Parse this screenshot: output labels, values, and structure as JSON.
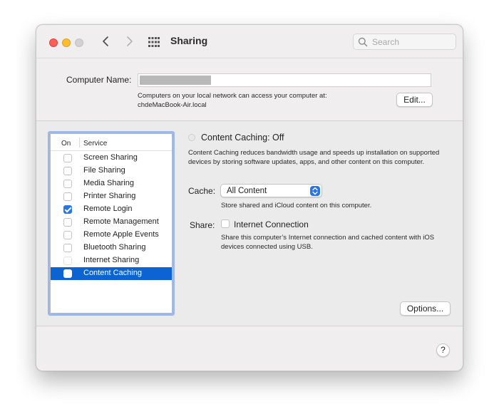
{
  "window": {
    "title": "Sharing",
    "search_placeholder": "Search"
  },
  "computer_name": {
    "label": "Computer Name:",
    "desc_line1": "Computers on your local network can access your computer at:",
    "desc_line2": "chdeMacBook-Air.local",
    "edit_button": "Edit..."
  },
  "service_list": {
    "header_on": "On",
    "header_service": "Service",
    "items": [
      {
        "label": "Screen Sharing",
        "checked": false
      },
      {
        "label": "File Sharing",
        "checked": false
      },
      {
        "label": "Media Sharing",
        "checked": false
      },
      {
        "label": "Printer Sharing",
        "checked": false
      },
      {
        "label": "Remote Login",
        "checked": true
      },
      {
        "label": "Remote Management",
        "checked": false
      },
      {
        "label": "Remote Apple Events",
        "checked": false
      },
      {
        "label": "Bluetooth Sharing",
        "checked": false
      },
      {
        "label": "Internet Sharing",
        "checked": false
      },
      {
        "label": "Content Caching",
        "checked": false,
        "selected": true
      }
    ]
  },
  "detail": {
    "status": "Content Caching: Off",
    "description": "Content Caching reduces bandwidth usage and speeds up installation on supported devices by storing software updates, apps, and other content on this computer.",
    "cache_label": "Cache:",
    "cache_value": "All Content",
    "cache_note": "Store shared and iCloud content on this computer.",
    "share_label": "Share:",
    "share_option": "Internet Connection",
    "share_checked": false,
    "share_note": "Share this computer’s Internet connection and cached content with iOS devices connected using USB.",
    "options_button": "Options..."
  },
  "help_button": "?",
  "colors": {
    "accent": "#0c64d3",
    "checkbox_blue": "#2a75e6",
    "close": "#fe5f57",
    "minimize": "#febc2e",
    "zoom_disabled": "#d3d2d2"
  }
}
